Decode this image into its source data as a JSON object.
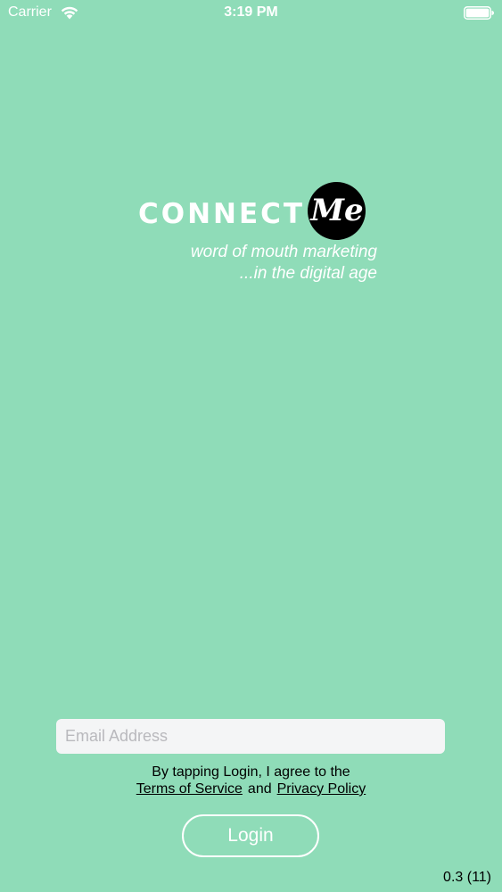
{
  "status_bar": {
    "carrier": "Carrier",
    "time": "3:19 PM",
    "wifi_icon": "wifi-icon",
    "battery_icon": "battery-icon"
  },
  "logo": {
    "word": "CONNECT",
    "circle_text": "Me",
    "tagline_line1": "word of mouth marketing",
    "tagline_line2": "...in the digital age"
  },
  "form": {
    "email_placeholder": "Email Address",
    "email_value": "",
    "agree_text": "By tapping Login, I agree to the",
    "terms_label": "Terms of Service",
    "and_label": "and",
    "privacy_label": "Privacy Policy",
    "login_label": "Login"
  },
  "footer": {
    "version": "0.3 (11)"
  },
  "colors": {
    "background": "#8fdcb8",
    "text_light": "#ffffff",
    "logo_circle": "#000000"
  }
}
